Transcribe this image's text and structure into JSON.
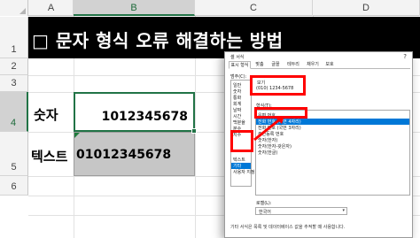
{
  "sheet": {
    "columns": [
      "A",
      "B",
      "C",
      "D"
    ],
    "rows": [
      "1",
      "2",
      "3",
      "4",
      "5",
      "6"
    ],
    "title": "□ 문자 형식 오류 해결하는 방법",
    "a4_label": "숫자",
    "b4_value": "1012345678",
    "a5_label": "텍스트",
    "b5_value": "01012345678"
  },
  "dialog": {
    "title": "셀 서식",
    "close": "?",
    "tabs": [
      "표시 형식",
      "맞춤",
      "글꼴",
      "테두리",
      "채우기",
      "보호"
    ],
    "category_label": "범주(C):",
    "categories": [
      "일반",
      "숫자",
      "통화",
      "회계",
      "날짜",
      "시간",
      "백분율",
      "분수",
      "지수",
      "텍스트",
      "기타",
      "사용자 지정"
    ],
    "selected_category_index": 10,
    "sample_label": "보기",
    "sample_value": "(010) 1234-5678",
    "type_label": "형식(T):",
    "types": [
      "우편 번호",
      "전화 번호 (국번 4자리)",
      "전화 번호 (국번 3자리)",
      "주민등록 번호",
      "숫자(한자)",
      "숫자(한자-갖은자)",
      "숫자(한글)"
    ],
    "selected_type_index": 1,
    "locale_label": "로캘(L):",
    "locale_value": "한국어",
    "description": "기타 서식은 목록 및 데이터베이스 값을 추적할 때 사용합니다."
  },
  "colors": {
    "annotation": "#ff0000",
    "selection": "#0078d7",
    "excel_green": "#217346"
  }
}
